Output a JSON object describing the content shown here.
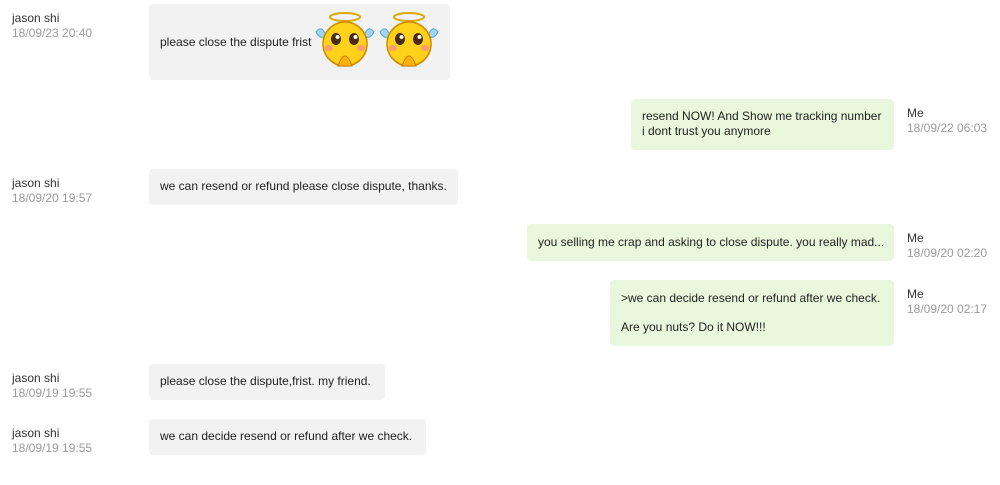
{
  "messages": [
    {
      "sender": "jason shi",
      "time": "18/09/23 20:40",
      "text": "please close the dispute frist",
      "emoji": [
        "angel-praying-emoji",
        "angel-praying-emoji"
      ]
    },
    {
      "sender": "Me",
      "time": "18/09/22 06:03",
      "lines": [
        "resend NOW! And Show me tracking number",
        "i dont trust you anymore"
      ]
    },
    {
      "sender": "jason shi",
      "time": "18/09/20 19:57",
      "text": "we can resend or refund please close dispute, thanks."
    },
    {
      "sender": "Me",
      "time": "18/09/20 02:20",
      "text": "you selling me crap and asking to close dispute. you really mad..."
    },
    {
      "sender": "Me",
      "time": "18/09/20 02:17",
      "lines": [
        ">we can decide resend or refund after we check.",
        "Are you nuts? Do it NOW!!!"
      ]
    },
    {
      "sender": "jason shi",
      "time": "18/09/19 19:55",
      "text": "please close the dispute,frist. my friend."
    },
    {
      "sender": "jason shi",
      "time": "18/09/19 19:55",
      "text": "we can decide resend or refund after we check."
    }
  ],
  "colors": {
    "incoming_bubble": "#f2f2f2",
    "outgoing_bubble": "#e9f7dc",
    "timestamp": "#9a9a9a"
  }
}
